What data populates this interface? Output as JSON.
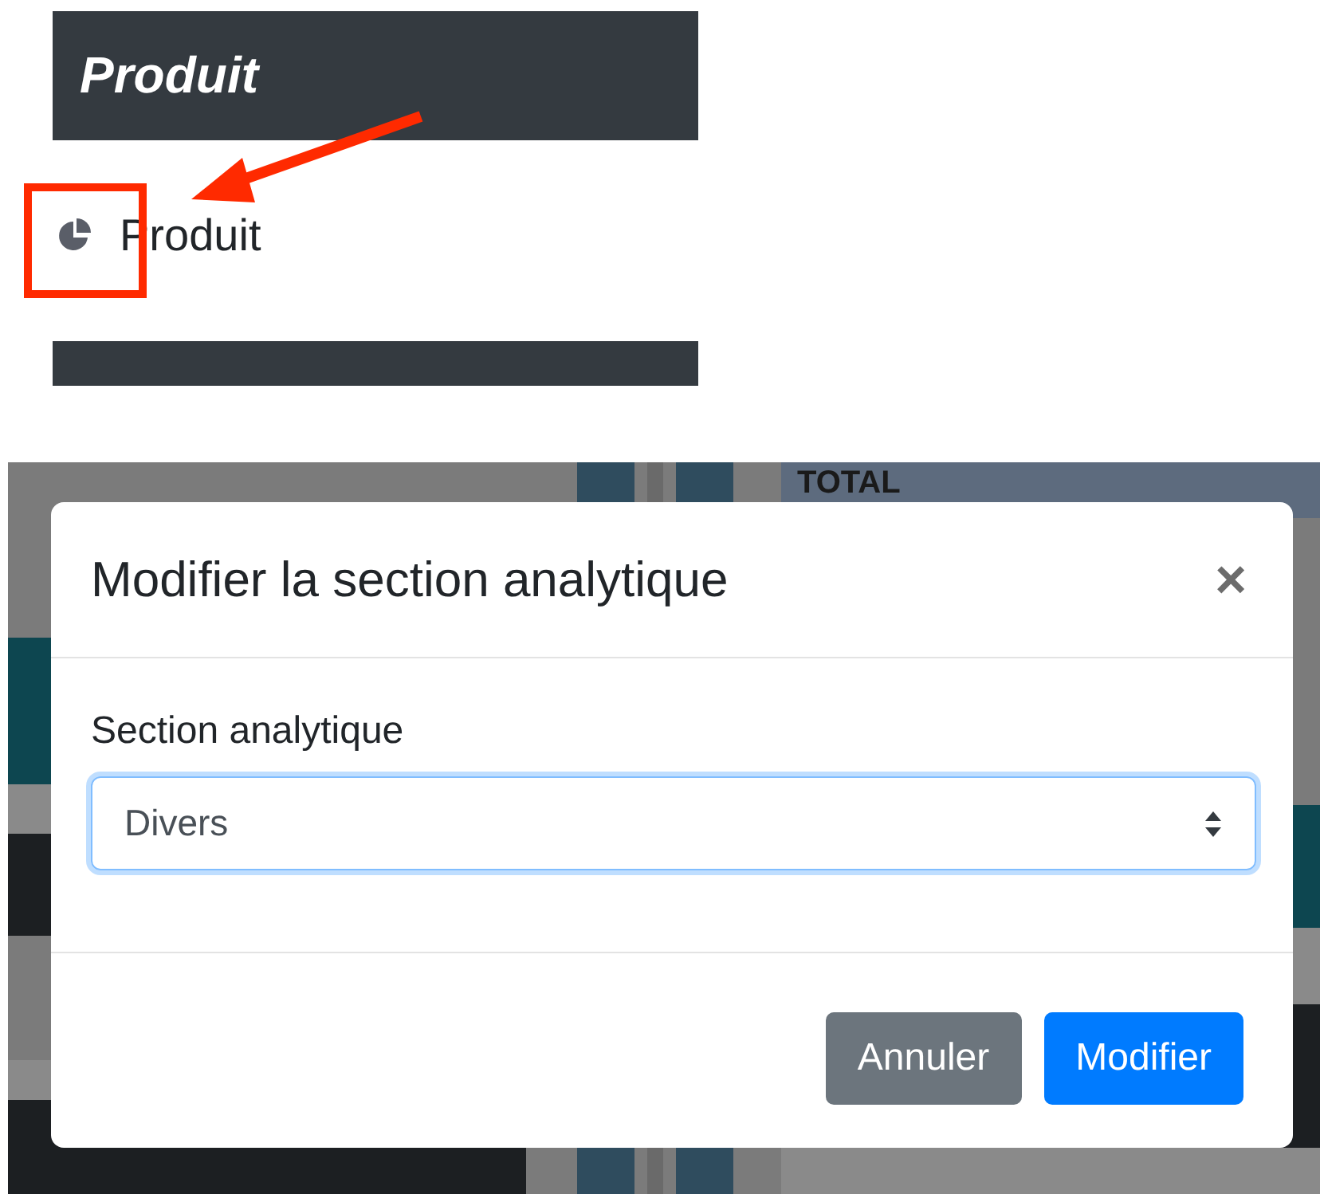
{
  "top_panel": {
    "header": "Produit",
    "item": {
      "label": "Produit"
    }
  },
  "background_page": {
    "column_heading": "TOTAL"
  },
  "modal": {
    "title": "Modifier la section analytique",
    "close": "×",
    "field": {
      "label": "Section analytique",
      "value": "Divers",
      "focused": true
    },
    "buttons": [
      {
        "label": "Annuler",
        "kind": "secondary"
      },
      {
        "label": "Modifier",
        "kind": "primary"
      }
    ]
  }
}
